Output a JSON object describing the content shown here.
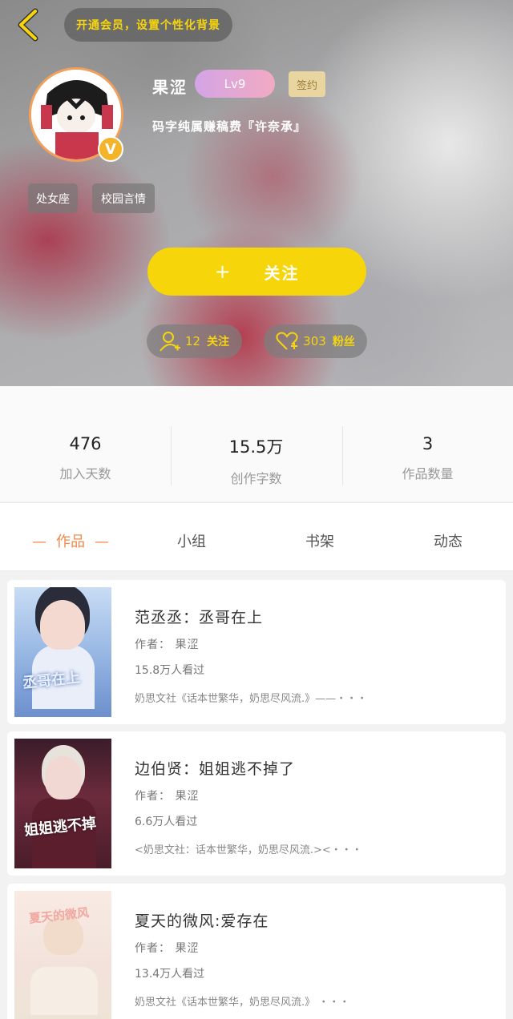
{
  "header": {
    "vip_prompt": "开通会员，设置个性化背景",
    "username": "果涩",
    "level": "Lv9",
    "signed_badge": "签约",
    "bio": "码字纯属赚稿费『许奈承』",
    "tags": [
      "处女座",
      "校园言情"
    ],
    "follow_button": {
      "plus": "+",
      "label": "关注"
    },
    "following": {
      "count": "12",
      "label": "关注"
    },
    "fans": {
      "count": "303",
      "label": "粉丝"
    },
    "verified_badge": "V"
  },
  "stats": [
    {
      "value": "476",
      "label": "加入天数"
    },
    {
      "value": "15.5万",
      "label": "创作字数"
    },
    {
      "value": "3",
      "label": "作品数量"
    }
  ],
  "tabs": [
    {
      "label": "作品",
      "dash": "—",
      "active": true
    },
    {
      "label": "小组"
    },
    {
      "label": "书架"
    },
    {
      "label": "动态"
    }
  ],
  "books": [
    {
      "title": "范丞丞：丞哥在上",
      "author": "作者：  果涩",
      "views": "15.8万人看过",
      "desc": "奶思文社《话本世繁华，奶思尽风流.》——・・・",
      "cover_text": "丞哥在上"
    },
    {
      "title": "边伯贤：姐姐逃不掉了",
      "author": "作者：  果涩",
      "views": "6.6万人看过",
      "desc": "<奶思文社：话本世繁华，奶思尽风流.><・・・",
      "cover_text": "姐姐逃不掉"
    },
    {
      "title": "夏天的微风:爱存在",
      "author": "作者：  果涩",
      "views": "13.4万人看过",
      "desc": "奶思文社《话本世繁华，奶思尽风流.》  ・・・",
      "cover_text": "夏天的微风"
    }
  ],
  "colors": {
    "accent_yellow": "#f7d50b",
    "tab_active": "#f0884a",
    "level_gradient_start": "#d4a4e6",
    "level_gradient_end": "#f2aac2"
  }
}
